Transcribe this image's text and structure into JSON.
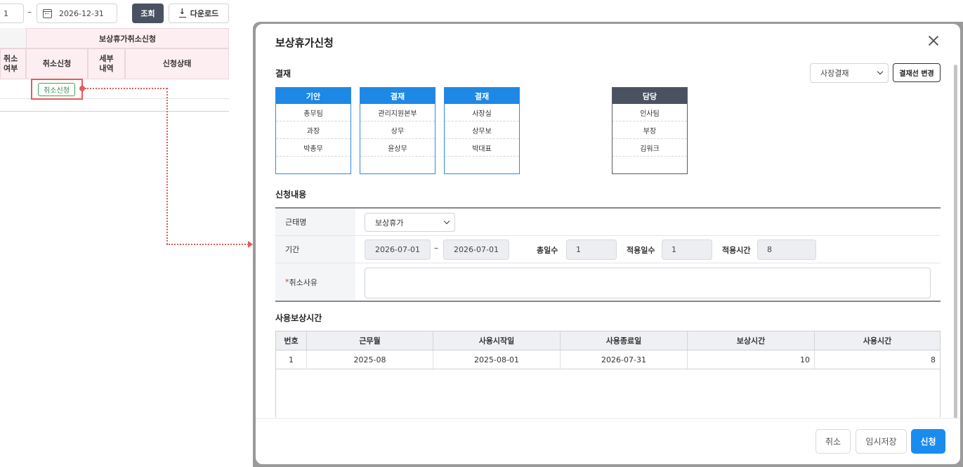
{
  "background": {
    "date_from_fragment": "1",
    "date_dash": "–",
    "date_to": "2026-12-31",
    "search_label": "조회",
    "download_label": "다운로드",
    "table_group_header": "보상휴가취소신청",
    "col_cut_header": "취소\n여부",
    "col_cancel_request": "취소신청",
    "col_detail": "세부\n내역",
    "col_status": "신청상태",
    "cancel_tag": "취소신청"
  },
  "modal": {
    "title": "보상휴가신청",
    "approval_section": "결재",
    "approval_select_value": "사장결재",
    "change_line_label": "결재선 변경",
    "approval_boxes": [
      {
        "head": "기안",
        "rows": [
          "총무팀",
          "과장",
          "박총무"
        ]
      },
      {
        "head": "결재",
        "rows": [
          "관리지원본부",
          "상무",
          "윤상무"
        ]
      },
      {
        "head": "결재",
        "rows": [
          "사장실",
          "상무보",
          "박대표"
        ]
      },
      {
        "head": "담당",
        "rows": [
          "인사팀",
          "부장",
          "김워크"
        ]
      }
    ],
    "request_section": "신청내용",
    "form": {
      "kind_label": "근태명",
      "kind_value": "보상휴가",
      "period_label": "기간",
      "period_start": "2026-07-01",
      "period_dash": "–",
      "period_end": "2026-07-01",
      "total_days_label": "총일수",
      "total_days": "1",
      "applied_days_label": "적용일수",
      "applied_days": "1",
      "applied_hours_label": "적용시간",
      "applied_hours": "8",
      "reason_required_mark": "*",
      "reason_label": "취소사유",
      "reason_value": ""
    },
    "usage_section": "사용보상시간",
    "usage_table": {
      "headers": [
        "번호",
        "근무월",
        "사용시작일",
        "사용종료일",
        "보상시간",
        "사용시간"
      ],
      "rows": [
        [
          "1",
          "2025-08",
          "2025-08-01",
          "2026-07-31",
          "10",
          "8"
        ]
      ]
    },
    "footer": {
      "cancel_label": "취소",
      "draft_label": "임시저장",
      "submit_label": "신청"
    }
  },
  "colors": {
    "approval_blue": "#1e88e5",
    "approval_dark": "#4a5262",
    "primary_button": "#1a8cf0",
    "highlight_red": "#e35b5b",
    "tag_green": "#3aa55b",
    "table_header_pink": "#fdeef2"
  },
  "icons": [
    "calendar-icon",
    "download-icon",
    "close-icon",
    "chevron-down-icon"
  ]
}
